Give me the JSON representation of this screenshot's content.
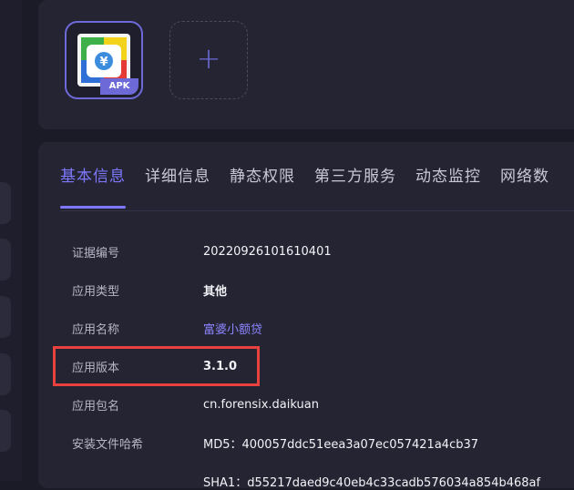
{
  "app_icon": {
    "badge": "APK"
  },
  "add_button": {
    "label": "+"
  },
  "tabs": [
    {
      "label": "基本信息",
      "active": true
    },
    {
      "label": "详细信息",
      "active": false
    },
    {
      "label": "静态权限",
      "active": false
    },
    {
      "label": "第三方服务",
      "active": false
    },
    {
      "label": "动态监控",
      "active": false
    },
    {
      "label": "网络数",
      "active": false
    }
  ],
  "info": {
    "evidence_no": {
      "label": "证据编号",
      "value": "20220926101610401"
    },
    "app_type": {
      "label": "应用类型",
      "value": "其他"
    },
    "app_name": {
      "label": "应用名称",
      "value": "富婆小额贷"
    },
    "app_version": {
      "label": "应用版本",
      "value": "3.1.0"
    },
    "package_name": {
      "label": "应用包名",
      "value": "cn.forensix.daikuan"
    },
    "file_hash": {
      "label": "安装文件哈希",
      "md5": "MD5：400057ddc51eea3a07ec057421a4cb37",
      "sha1": "SHA1：d55217daed9c40eb4c33cadb576034a854b468af"
    }
  },
  "colors": {
    "background": "#1b1a27",
    "card": "#252433",
    "accent": "#7d78ff",
    "highlight": "#e8413e"
  }
}
